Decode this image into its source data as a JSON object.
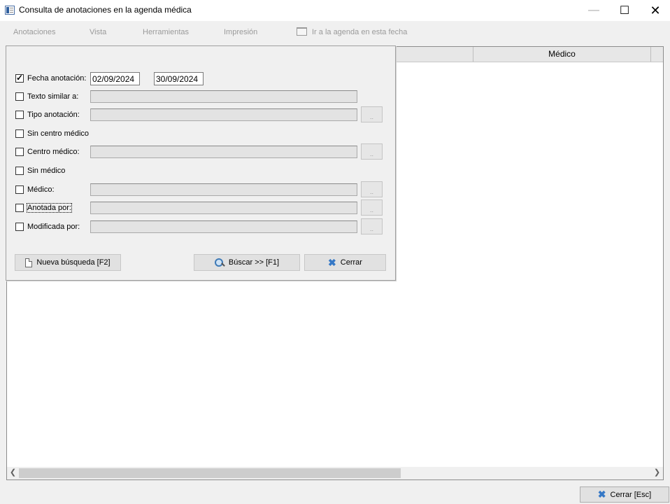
{
  "window": {
    "title": "Consulta de anotaciones en la agenda médica",
    "minimize_glyph": "—",
    "maximize_glyph": "☐",
    "close_glyph": "✕"
  },
  "menu": {
    "items": [
      "Anotaciones",
      "Vista",
      "Herramientas",
      "Impresión"
    ],
    "ir_agenda_label": "Ir a la agenda en esta fecha"
  },
  "grid": {
    "columns": [
      "",
      "Médico",
      ""
    ]
  },
  "panel": {
    "fecha_label": "Fecha anotación:",
    "fecha_desde": "02/09/2024",
    "fecha_hasta": "30/09/2024",
    "texto_label": "Texto similar a:",
    "tipo_label": "Tipo anotación:",
    "sin_centro_label": "Sin centro médico",
    "centro_label": "Centro médico:",
    "sin_medico_label": "Sin médico",
    "medico_label": "Médico:",
    "anotada_label": "Anotada por:",
    "modificada_label": "Modificada por:",
    "dots": "..",
    "new_search_label": "Nueva búsqueda  [F2]",
    "search_label": "Búscar  >>  [F1]",
    "close_label": "Cerrar"
  },
  "footer": {
    "close_esc_label": "Cerrar  [Esc]"
  },
  "icons": {
    "close_x_color": "#3578c6"
  }
}
